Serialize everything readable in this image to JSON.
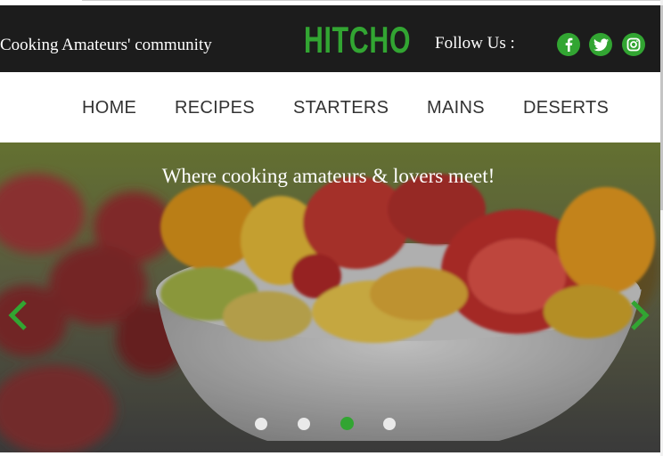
{
  "header": {
    "tagline": "Cooking Amateurs' community",
    "logo": "HITCHO",
    "follow_label": "Follow Us :",
    "social": [
      "facebook-icon",
      "twitter-icon",
      "instagram-icon"
    ]
  },
  "nav": {
    "items": [
      {
        "label": "HOME"
      },
      {
        "label": "RECIPES"
      },
      {
        "label": "STARTERS"
      },
      {
        "label": "MAINS"
      },
      {
        "label": "DESERTS"
      }
    ]
  },
  "carousel": {
    "caption": "Where cooking amateurs & lovers meet!",
    "slide_count": 4,
    "active_slide": 3,
    "prev_icon": "chevron-left-icon",
    "next_icon": "chevron-right-icon"
  },
  "colors": {
    "accent": "#32a532",
    "topbar_bg": "#1c1c1c",
    "nav_text": "#333333"
  }
}
